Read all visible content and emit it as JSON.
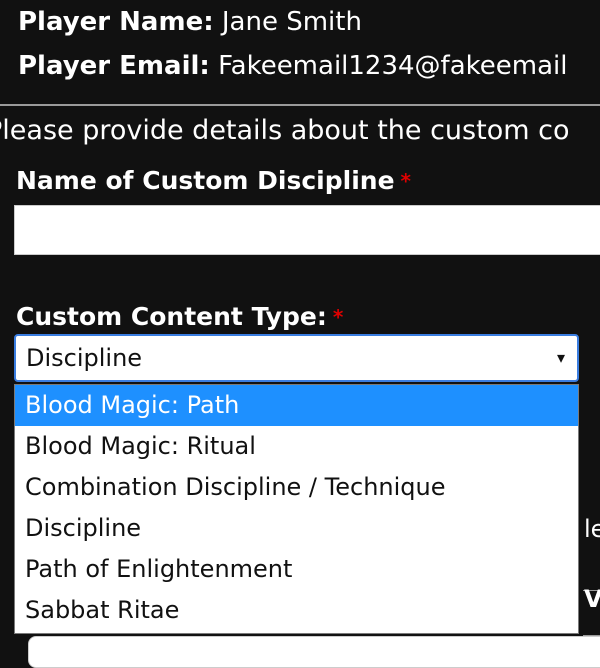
{
  "player": {
    "name_label": "Player Name:",
    "name_value": "Jane Smith",
    "email_label": "Player Email:",
    "email_value": "Fakeemail1234@fakeemail"
  },
  "intro_text": "Please provide details about the custom co",
  "custom_discipline": {
    "label": "Name of Custom Discipline",
    "required_mark": "*",
    "value": ""
  },
  "content_type": {
    "label": "Custom Content Type:",
    "required_mark": "*",
    "selected": "Discipline",
    "arrow": "▾",
    "options": [
      "Blood Magic: Path",
      "Blood Magic: Ritual",
      "Combination Discipline / Technique",
      "Discipline",
      "Path of Enlightenment",
      "Sabbat Ritae"
    ],
    "highlighted_index": 0
  },
  "partial_text": {
    "le": "le",
    "v": "V"
  },
  "colors": {
    "background": "#111111",
    "required": "#e00000",
    "highlight": "#1e90ff",
    "focus_border": "#3a7de0"
  }
}
